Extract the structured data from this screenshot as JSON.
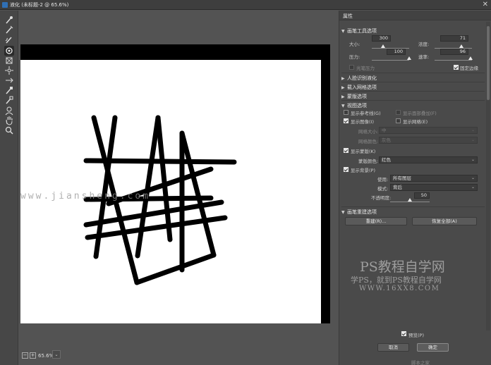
{
  "window": {
    "title": "液化 (未标题-2 @ 65.6%)",
    "close_glyph": "✕"
  },
  "tools": [
    "forward-warp-icon",
    "reconstruct-icon",
    "smooth-icon",
    "twirl-icon",
    "pucker-icon",
    "bloat-icon",
    "push-left-icon",
    "freeze-mask-icon",
    "thaw-mask-icon",
    "face-tool-icon",
    "hand-icon",
    "zoom-icon"
  ],
  "status": {
    "zoom_minus": "−",
    "zoom_plus": "+",
    "zoom": "65.6%",
    "caret": "⌄"
  },
  "canvas_watermark": "www.jiansheng.com",
  "panel": {
    "title": "属性",
    "brush": {
      "header": "画笔工具选项",
      "size_label": "大小:",
      "size": "300",
      "size_level": 0.3,
      "density_label": "浓度:",
      "density": "71",
      "density_level": 0.71,
      "pressure_label": "压力:",
      "pressure": "100",
      "pressure_level": 1.0,
      "rate_label": "速率:",
      "rate": "96",
      "rate_level": 0.96,
      "stylus_label": "光笔压力",
      "pin_edges_label": "固定边缘"
    },
    "face_aware": "人脸识别液化",
    "load_mesh": "载入网格选项",
    "mask": "蒙版选项",
    "view": {
      "header": "视图选项",
      "show_guides": "显示参考线(G)",
      "show_face_overlay": "显示面部叠加(F)",
      "show_image": "显示图像(I)",
      "show_mesh": "显示网格(E)",
      "mesh_size_label": "网格大小:",
      "mesh_size": "中",
      "mesh_color_label": "网格颜色:",
      "mesh_color": "灰色",
      "show_mask": "显示蒙版(K)",
      "mask_color_label": "蒙版颜色:",
      "mask_color": "红色",
      "show_backdrop": "显示背景(P)",
      "use_label": "使用:",
      "use_value": "所有图层",
      "mode_label": "模式:",
      "mode_value": "背后",
      "opacity_label": "不透明度:",
      "opacity": "50",
      "opacity_level": 0.5
    },
    "reconstruct": {
      "header": "画笔重建选项",
      "rebuild": "重建(R)...",
      "restore_all": "恢复全部(A)"
    },
    "preview_label": "预览(P)",
    "cancel": "取消",
    "ok": "确定",
    "footer_watermark": "脚本之家"
  },
  "watermark": {
    "line1": "PS教程自学网",
    "line2": "学PS，就到PS教程自学网",
    "line3": "WWW.16XX8.COM"
  },
  "colors": {
    "panel_bg": "#4a4a4a",
    "canvas_bg": "#535353",
    "stroke": "#000000"
  }
}
